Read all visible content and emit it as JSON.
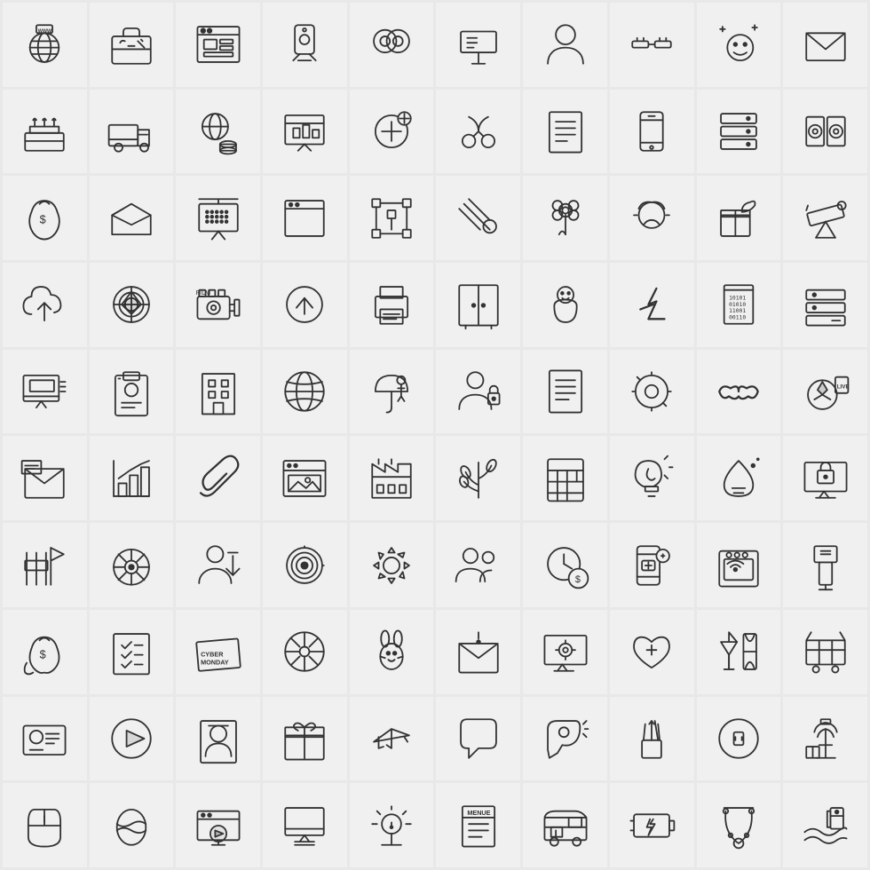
{
  "grid": {
    "cols": 10,
    "rows": 10,
    "icons": [
      "www-globe",
      "briefcase",
      "browser-window",
      "tag-scanner",
      "settings-circles",
      "signboard",
      "person-user",
      "cable-connector",
      "sparkle-face",
      "envelope",
      "birthday-cake",
      "delivery-truck",
      "globe-database",
      "chart-presentation",
      "medical-plus",
      "ribbon-scissors",
      "receipt-list",
      "mobile-phone",
      "server-stack",
      "film-reels",
      "sack-dollar",
      "email-open",
      "presentation-board",
      "browser-empty",
      "vector-design",
      "meteor-streak",
      "flower-plant",
      "profile-head",
      "gift-moon",
      "telescope",
      "cloud-upload",
      "radar-chart",
      "film-camera",
      "arrow-up-circle",
      "receipt-printer",
      "wardrobe-closet",
      "baby-swaddle",
      "litecoin",
      "binary-book",
      "server-minus",
      "monitor-layers",
      "id-badge",
      "building",
      "globe-sphere",
      "umbrella-person",
      "person-lock",
      "document-lines",
      "settings-dial",
      "mustache",
      "soccer-live",
      "news-envelope",
      "bar-chart-up",
      "paperclip",
      "browser-image",
      "factory-building",
      "plant-branch",
      "telephone-calc",
      "lightbulb-apple",
      "water-drop",
      "monitor-lock",
      "fence-flag",
      "roulette-wheel",
      "person-download",
      "target-dart",
      "gear-cog",
      "person-group",
      "clock-dollar",
      "phone-medicine",
      "oven-wifi",
      "usb-dock",
      "money-bag-hand",
      "checklist",
      "cyber-monday",
      "wheel-mandala",
      "easter-bunny",
      "envelope-alert",
      "gear-monitor",
      "heart-plus",
      "tree-hourglass",
      "cart-tools",
      "id-card",
      "play-button",
      "person-profile",
      "gift-box",
      "airplane",
      "chat-bubble",
      "hair-dryer",
      "pencil-cup",
      "power-socket",
      "airport-tower",
      "computer-mouse",
      "easter-egg",
      "video-screen",
      "monitor-stand",
      "warning-lamp",
      "menu-document",
      "food-truck",
      "battery-bolt",
      "necklace",
      "water-scene"
    ]
  }
}
